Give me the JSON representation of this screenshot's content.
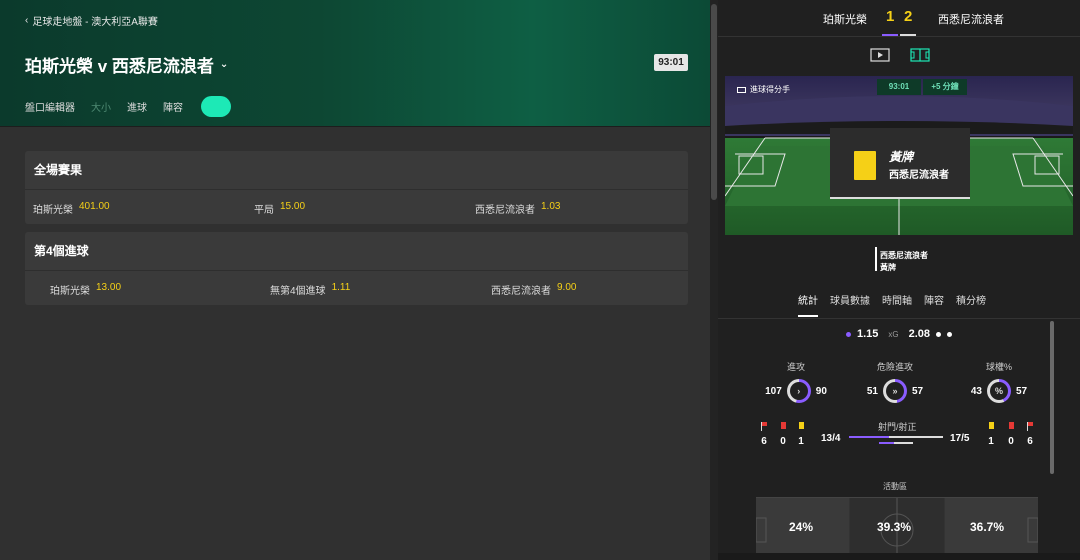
{
  "header": {
    "breadcrumb": "足球走地盤 - 澳大利亞A聯賽",
    "match_title": "珀斯光榮 v 西悉尼流浪者",
    "clock": "93:01",
    "filters": [
      "盤口編輯器",
      "大小",
      "進球",
      "陣容"
    ],
    "toggle_on": true
  },
  "markets": [
    {
      "title": "全場賽果",
      "odds": [
        {
          "name": "珀斯光榮",
          "price": "401.00"
        },
        {
          "name": "平局",
          "price": "15.00"
        },
        {
          "name": "西悉尼流浪者",
          "price": "1.03"
        }
      ]
    },
    {
      "title": "第4個進球",
      "odds": [
        {
          "name": "珀斯光榮",
          "price": "13.00"
        },
        {
          "name": "無第4個進球",
          "price": "1.11"
        },
        {
          "name": "西悉尼流浪者",
          "price": "9.00"
        }
      ]
    }
  ],
  "scoreboard": {
    "home": "珀斯光榮",
    "away": "西悉尼流浪者",
    "home_score": "1",
    "away_score": "2"
  },
  "pitch": {
    "label": "進球得分手",
    "time": "93:01",
    "added": "+5 分鐘",
    "event_title": "黃牌",
    "event_team": "西悉尼流浪者",
    "footer_team": "西悉尼流浪者",
    "footer_event": "黃牌"
  },
  "stat_tabs": [
    "統計",
    "球員數據",
    "時間軸",
    "陣容",
    "積分榜"
  ],
  "stats": {
    "xg_label": "xG",
    "xg_home": "1.15",
    "xg_away": "2.08",
    "attacks": {
      "title": "進攻",
      "home": "107",
      "away": "90"
    },
    "dangerous": {
      "title": "危險進攻",
      "home": "51",
      "away": "57"
    },
    "possession": {
      "title": "球權%",
      "home": "43",
      "away": "57"
    },
    "shots_title": "射門/射正",
    "shots_home": "13/4",
    "shots_away": "17/5",
    "home_corners": "6",
    "home_red": "0",
    "home_yellow": "1",
    "away_yellow": "1",
    "away_red": "0",
    "away_corners": "6",
    "zone_title": "活動區",
    "zone": [
      "24%",
      "39.3%",
      "36.7%"
    ]
  },
  "colors": {
    "accent": "#1de9b6",
    "odds": "#f5d017",
    "home": "#8a5cff",
    "away": "#ffffff"
  }
}
